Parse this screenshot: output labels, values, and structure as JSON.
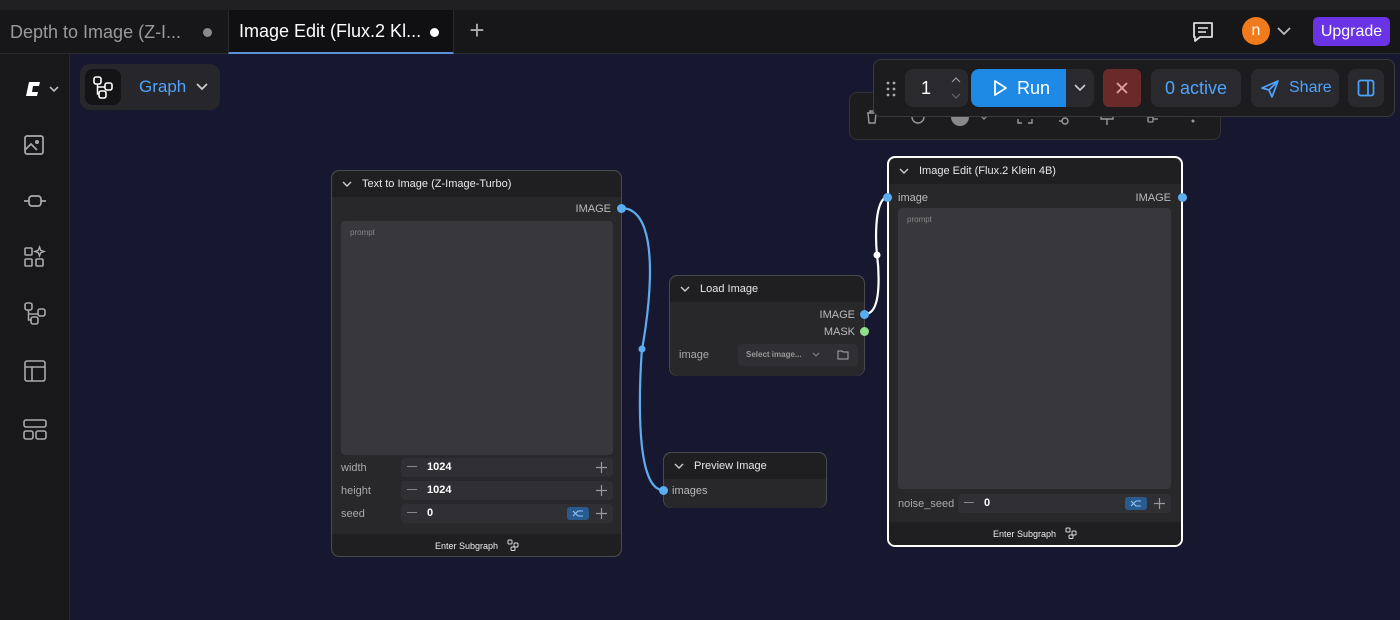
{
  "tabs": [
    {
      "label": "Depth to Image (Z-I..."
    },
    {
      "label": "Image Edit (Flux.2 Kl..."
    }
  ],
  "header": {
    "avatar_initial": "n",
    "upgrade_label": "Upgrade"
  },
  "sidebar": {
    "items": [
      {
        "icon": "comfy-logo-icon"
      },
      {
        "icon": "image-assets-icon"
      },
      {
        "icon": "node-library-icon"
      },
      {
        "icon": "models-icon"
      },
      {
        "icon": "workflows-icon"
      },
      {
        "icon": "templates-icon"
      },
      {
        "icon": "apps-icon"
      }
    ]
  },
  "graph_menu": {
    "label": "Graph"
  },
  "run_toolbar": {
    "batch_count": "1",
    "run_label": "Run",
    "active_label": "0 active",
    "share_label": "Share"
  },
  "nodes": {
    "text_to_image": {
      "title": "Text to Image (Z-Image-Turbo)",
      "output": "IMAGE",
      "prompt_placeholder": "prompt",
      "width_label": "width",
      "width_value": "1024",
      "height_label": "height",
      "height_value": "1024",
      "seed_label": "seed",
      "seed_value": "0",
      "footer": "Enter Subgraph"
    },
    "load_image": {
      "title": "Load Image",
      "output_image": "IMAGE",
      "output_mask": "MASK",
      "image_label": "image",
      "select_placeholder": "Select image..."
    },
    "preview_image": {
      "title": "Preview Image",
      "input": "images"
    },
    "image_edit": {
      "title": "Image Edit (Flux.2 Klein 4B)",
      "input": "image",
      "output": "IMAGE",
      "prompt_placeholder": "prompt",
      "noise_seed_label": "noise_seed",
      "noise_seed_value": "0",
      "footer": "Enter Subgraph"
    }
  },
  "colors": {
    "accent": "#1e8ae6",
    "link_text": "#4fa3ff",
    "upgrade": "#6a33e6",
    "avatar": "#f07b1c",
    "canvas": "#17172f",
    "wire": "#5aaef0"
  }
}
